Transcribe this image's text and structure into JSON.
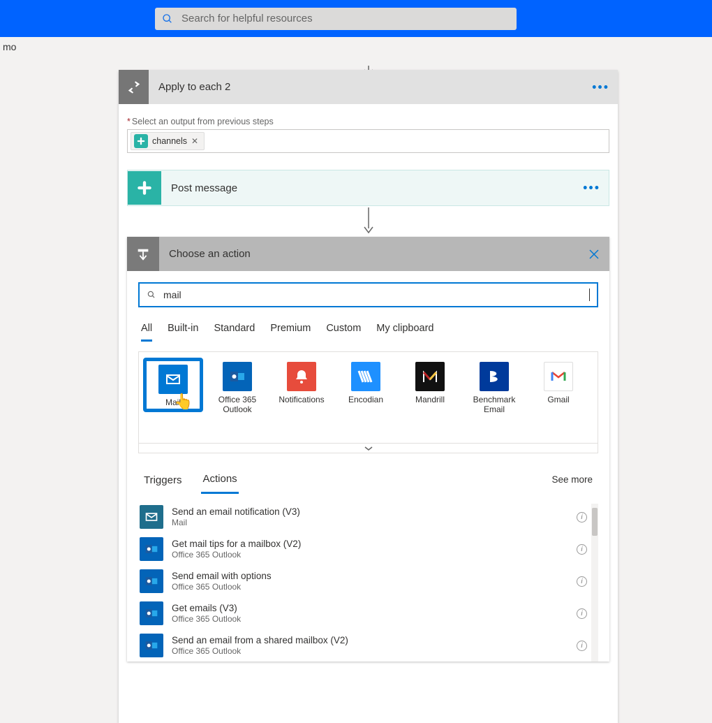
{
  "top_search_placeholder": "Search for helpful resources",
  "breadcrumb_fragment": "mo",
  "apply_each": {
    "title": "Apply to each 2",
    "output_label": "Select an output from previous steps",
    "token_label": "channels"
  },
  "post_message_title": "Post message",
  "choose_action": {
    "title": "Choose an action",
    "search_value": "mail",
    "filters": [
      "All",
      "Built-in",
      "Standard",
      "Premium",
      "Custom",
      "My clipboard"
    ],
    "filters_active": 0,
    "connectors": [
      {
        "label": "Mail",
        "icon": "mail"
      },
      {
        "label": "Office 365 Outlook",
        "icon": "outlook"
      },
      {
        "label": "Notifications",
        "icon": "notif"
      },
      {
        "label": "Encodian",
        "icon": "encod"
      },
      {
        "label": "Mandrill",
        "icon": "mandr"
      },
      {
        "label": "Benchmark Email",
        "icon": "bench"
      },
      {
        "label": "Gmail",
        "icon": "gmail"
      }
    ],
    "ta_tabs": [
      "Triggers",
      "Actions"
    ],
    "ta_active": 1,
    "see_more": "See more",
    "actions": [
      {
        "title": "Send an email notification (V3)",
        "sub": "Mail",
        "icon": "mail"
      },
      {
        "title": "Get mail tips for a mailbox (V2)",
        "sub": "Office 365 Outlook",
        "icon": "outlook"
      },
      {
        "title": "Send email with options",
        "sub": "Office 365 Outlook",
        "icon": "outlook"
      },
      {
        "title": "Get emails (V3)",
        "sub": "Office 365 Outlook",
        "icon": "outlook"
      },
      {
        "title": "Send an email from a shared mailbox (V2)",
        "sub": "Office 365 Outlook",
        "icon": "outlook"
      }
    ]
  }
}
